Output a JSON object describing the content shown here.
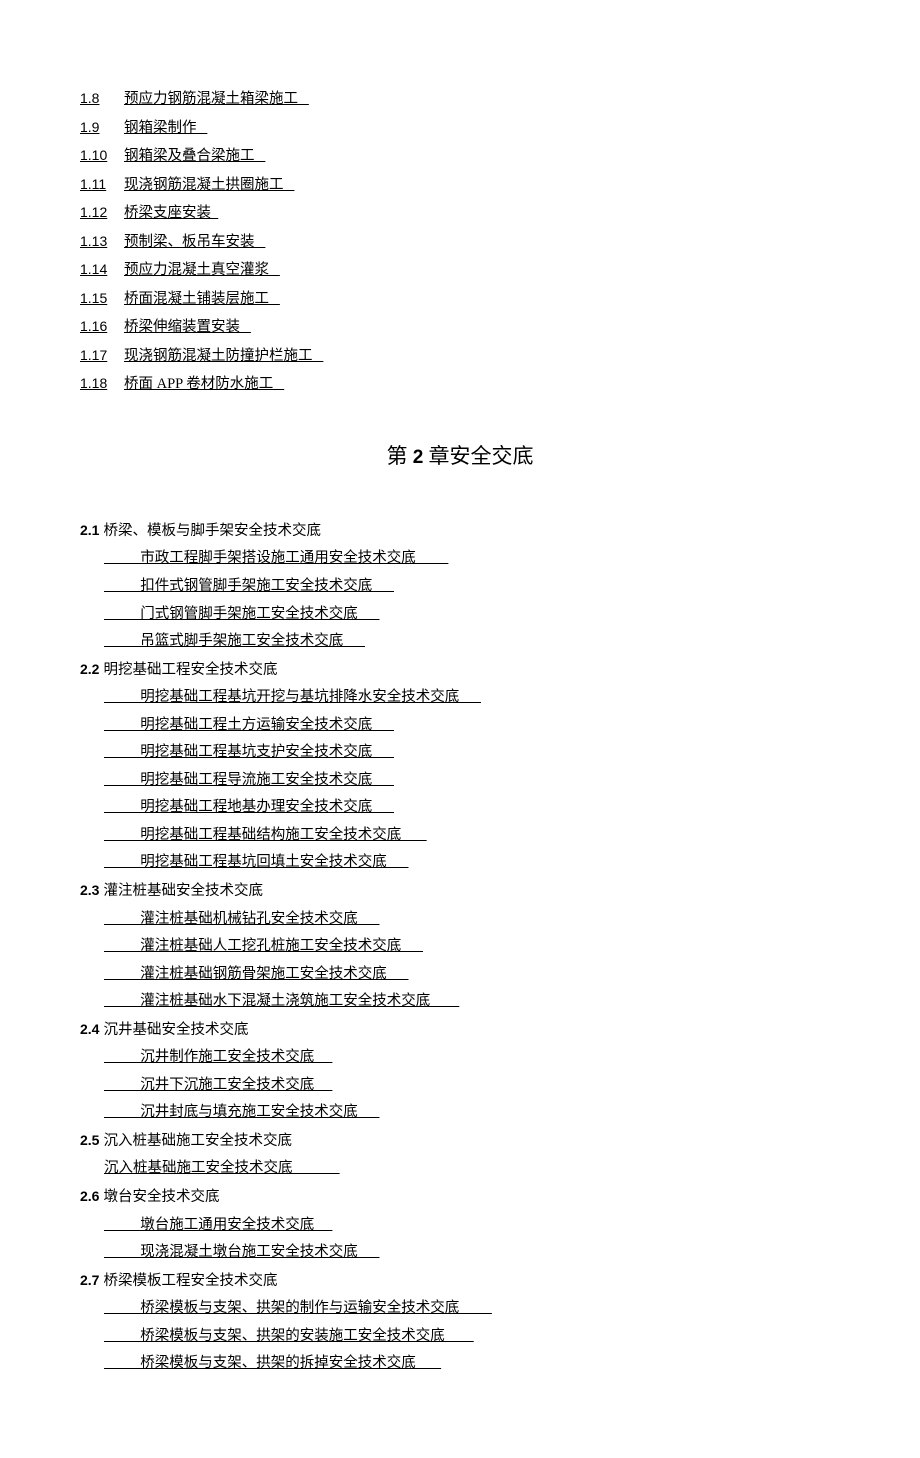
{
  "top_links": [
    {
      "num": "1.8",
      "label": "预应力钢筋混凝土箱梁施工   "
    },
    {
      "num": "1.9",
      "label": "钢箱梁制作   "
    },
    {
      "num": "1.10",
      "label": "钢箱梁及叠合梁施工   "
    },
    {
      "num": "1.11",
      "label": "现浇钢筋混凝土拱圈施工   "
    },
    {
      "num": "1.12",
      "label": "桥梁支座安装  "
    },
    {
      "num": "1.13",
      "label": "预制梁、板吊车安装   "
    },
    {
      "num": "1.14",
      "label": "预应力混凝土真空灌浆   "
    },
    {
      "num": "1.15",
      "label": "桥面混凝土铺装层施工   "
    },
    {
      "num": "1.16",
      "label": "桥梁伸缩装置安装   "
    },
    {
      "num": "1.17",
      "label": "现浇钢筋混凝土防撞护栏施工   "
    },
    {
      "num": "1.18",
      "label": "桥面 APP 卷材防水施工   "
    }
  ],
  "chapter": {
    "prefix": "第",
    "num": "2",
    "suffix": "章安全交底"
  },
  "sections": [
    {
      "num": "2.1",
      "title": "桥梁、模板与脚手架安全技术交底",
      "items": [
        "          市政工程脚手架搭设施工通用安全技术交底         ",
        "          扣件式钢管脚手架施工安全技术交底      ",
        "          门式钢管脚手架施工安全技术交底      ",
        "          吊篮式脚手架施工安全技术交底      "
      ]
    },
    {
      "num": "2.2",
      "title": "明挖基础工程安全技术交底",
      "items": [
        "          明挖基础工程基坑开挖与基坑排降水安全技术交底      ",
        "          明挖基础工程土方运输安全技术交底      ",
        "          明挖基础工程基坑支护安全技术交底      ",
        "          明挖基础工程导流施工安全技术交底      ",
        "          明挖基础工程地基办理安全技术交底      ",
        "          明挖基础工程基础结构施工安全技术交底       ",
        "          明挖基础工程基坑回填土安全技术交底      "
      ]
    },
    {
      "num": "2.3",
      "title": "灌注桩基础安全技术交底",
      "items": [
        "          灌注桩基础机械钻孔安全技术交底      ",
        "          灌注桩基础人工挖孔桩施工安全技术交底      ",
        "          灌注桩基础钢筋骨架施工安全技术交底      ",
        "          灌注桩基础水下混凝土浇筑施工安全技术交底        "
      ]
    },
    {
      "num": "2.4",
      "title": "沉井基础安全技术交底",
      "items": [
        "          沉井制作施工安全技术交底     ",
        "          沉井下沉施工安全技术交底     ",
        "          沉井封底与填充施工安全技术交底      "
      ]
    },
    {
      "num": "2.5",
      "title": "沉入桩基础施工安全技术交底",
      "items_flush": [
        "沉入桩基础施工安全技术交底             "
      ]
    },
    {
      "num": "2.6",
      "title": "墩台安全技术交底",
      "items": [
        "          墩台施工通用安全技术交底     ",
        "          现浇混凝土墩台施工安全技术交底      "
      ]
    },
    {
      "num": "2.7",
      "title": "桥梁模板工程安全技术交底",
      "items": [
        "          桥梁模板与支架、拱架的制作与运输安全技术交底         ",
        "          桥梁模板与支架、拱架的安装施工安全技术交底        ",
        "          桥梁模板与支架、拱架的拆掉安全技术交底       "
      ]
    }
  ]
}
